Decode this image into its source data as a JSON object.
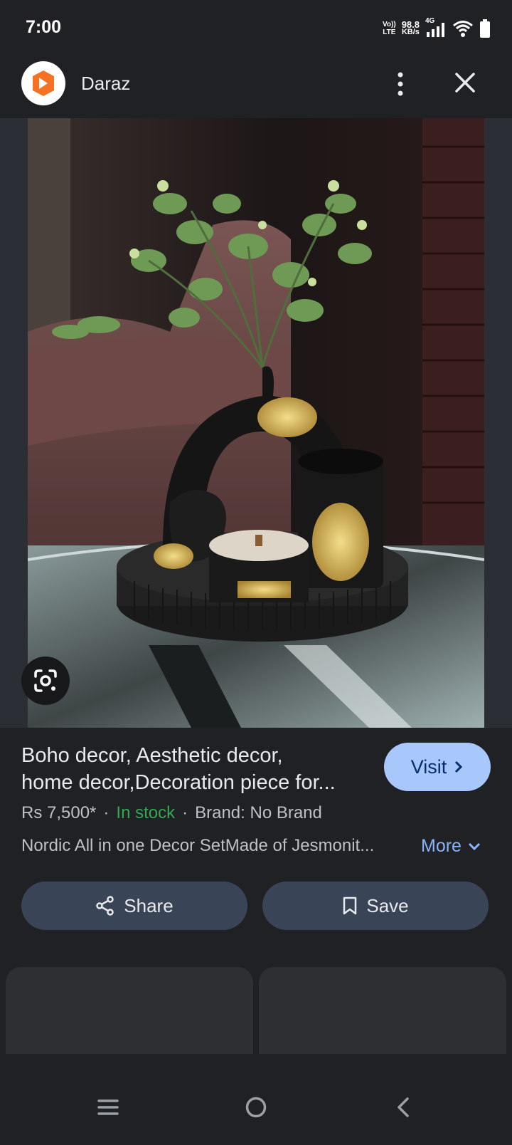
{
  "status_bar": {
    "time": "7:00",
    "volte_top": "Vo))",
    "volte_bottom": "LTE",
    "speed_value": "98.8",
    "speed_unit": "KB/s",
    "network": "4G",
    "icons": [
      "signal-icon",
      "wifi-icon",
      "battery-icon"
    ]
  },
  "header": {
    "site_name": "Daraz",
    "logo_icon": "daraz-logo-icon",
    "logo_color": "#f57224",
    "more_icon": "more-vert-icon",
    "close_icon": "close-icon"
  },
  "image": {
    "lens_icon": "google-lens-icon"
  },
  "product": {
    "title_line1": "Boho decor, Aesthetic decor,",
    "title_line2": "home decor,Decoration piece for...",
    "price": "Rs 7,500*",
    "stock": "In stock",
    "brand": "Brand: No Brand",
    "description": "Nordic All in one Decor SetMade of Jesmonit...",
    "more_label": "More"
  },
  "actions": {
    "visit_label": "Visit",
    "share_label": "Share",
    "save_label": "Save"
  },
  "nav": {
    "icons": [
      "recent-apps-icon",
      "home-icon",
      "back-icon"
    ]
  },
  "colors": {
    "background": "#202124",
    "accent": "#a8c7fa",
    "stock_green": "#34a853",
    "link_blue": "#8ab4f8"
  }
}
